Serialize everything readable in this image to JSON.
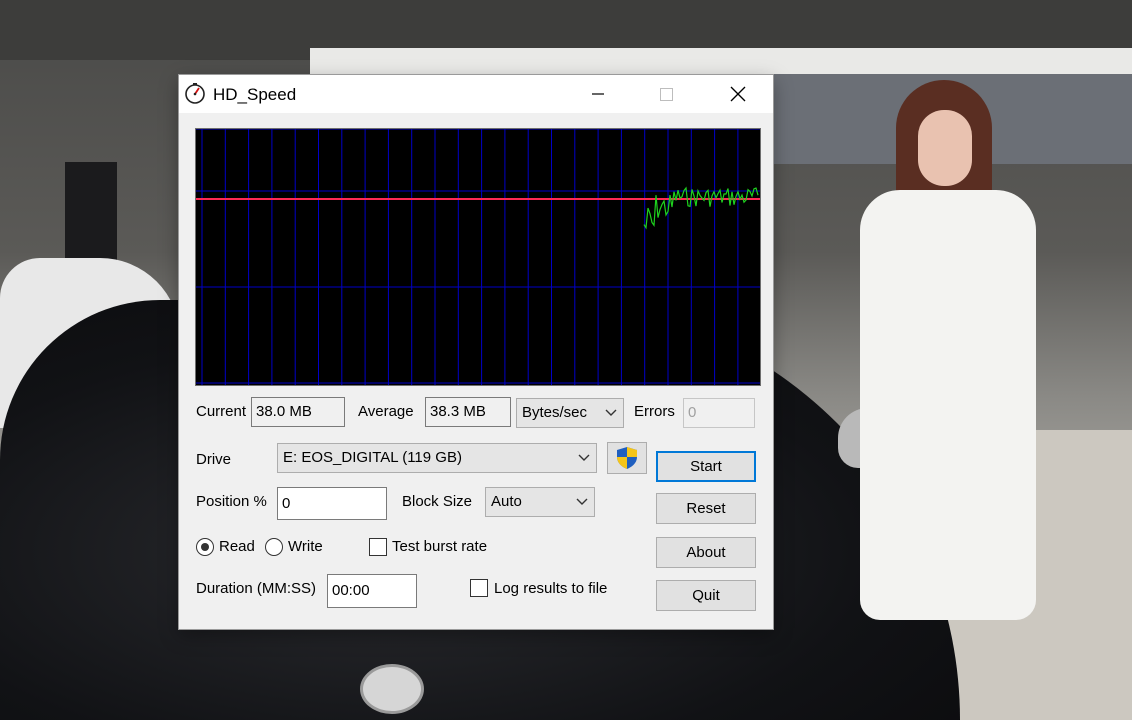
{
  "window": {
    "title": "HD_Speed",
    "title_icon": "stopwatch-icon",
    "controls": [
      "minimize-icon",
      "maximize-icon",
      "close-icon"
    ]
  },
  "graph": {
    "background": "#000000",
    "grid_color": "#0000c8",
    "average_line_color": "#ff2a55",
    "trace_color": "#1ed21e"
  },
  "stats": {
    "current_label": "Current",
    "current_value": "38.0 MB",
    "average_label": "Average",
    "average_value": "38.3 MB",
    "units_selected": "Bytes/sec",
    "errors_label": "Errors",
    "errors_value": "0"
  },
  "drive": {
    "label": "Drive",
    "selected": "E: EOS_DIGITAL (119 GB)",
    "admin_icon": "uac-shield-icon"
  },
  "position": {
    "label": "Position %",
    "value": "0"
  },
  "block_size": {
    "label": "Block Size",
    "selected": "Auto"
  },
  "mode": {
    "read_label": "Read",
    "write_label": "Write",
    "selected": "Read"
  },
  "burst": {
    "label": "Test burst rate",
    "checked": false
  },
  "duration": {
    "label": "Duration (MM:SS)",
    "value": "00:00"
  },
  "log": {
    "label": "Log results to file",
    "checked": false
  },
  "buttons": {
    "start": "Start",
    "reset": "Reset",
    "about": "About",
    "quit": "Quit"
  }
}
